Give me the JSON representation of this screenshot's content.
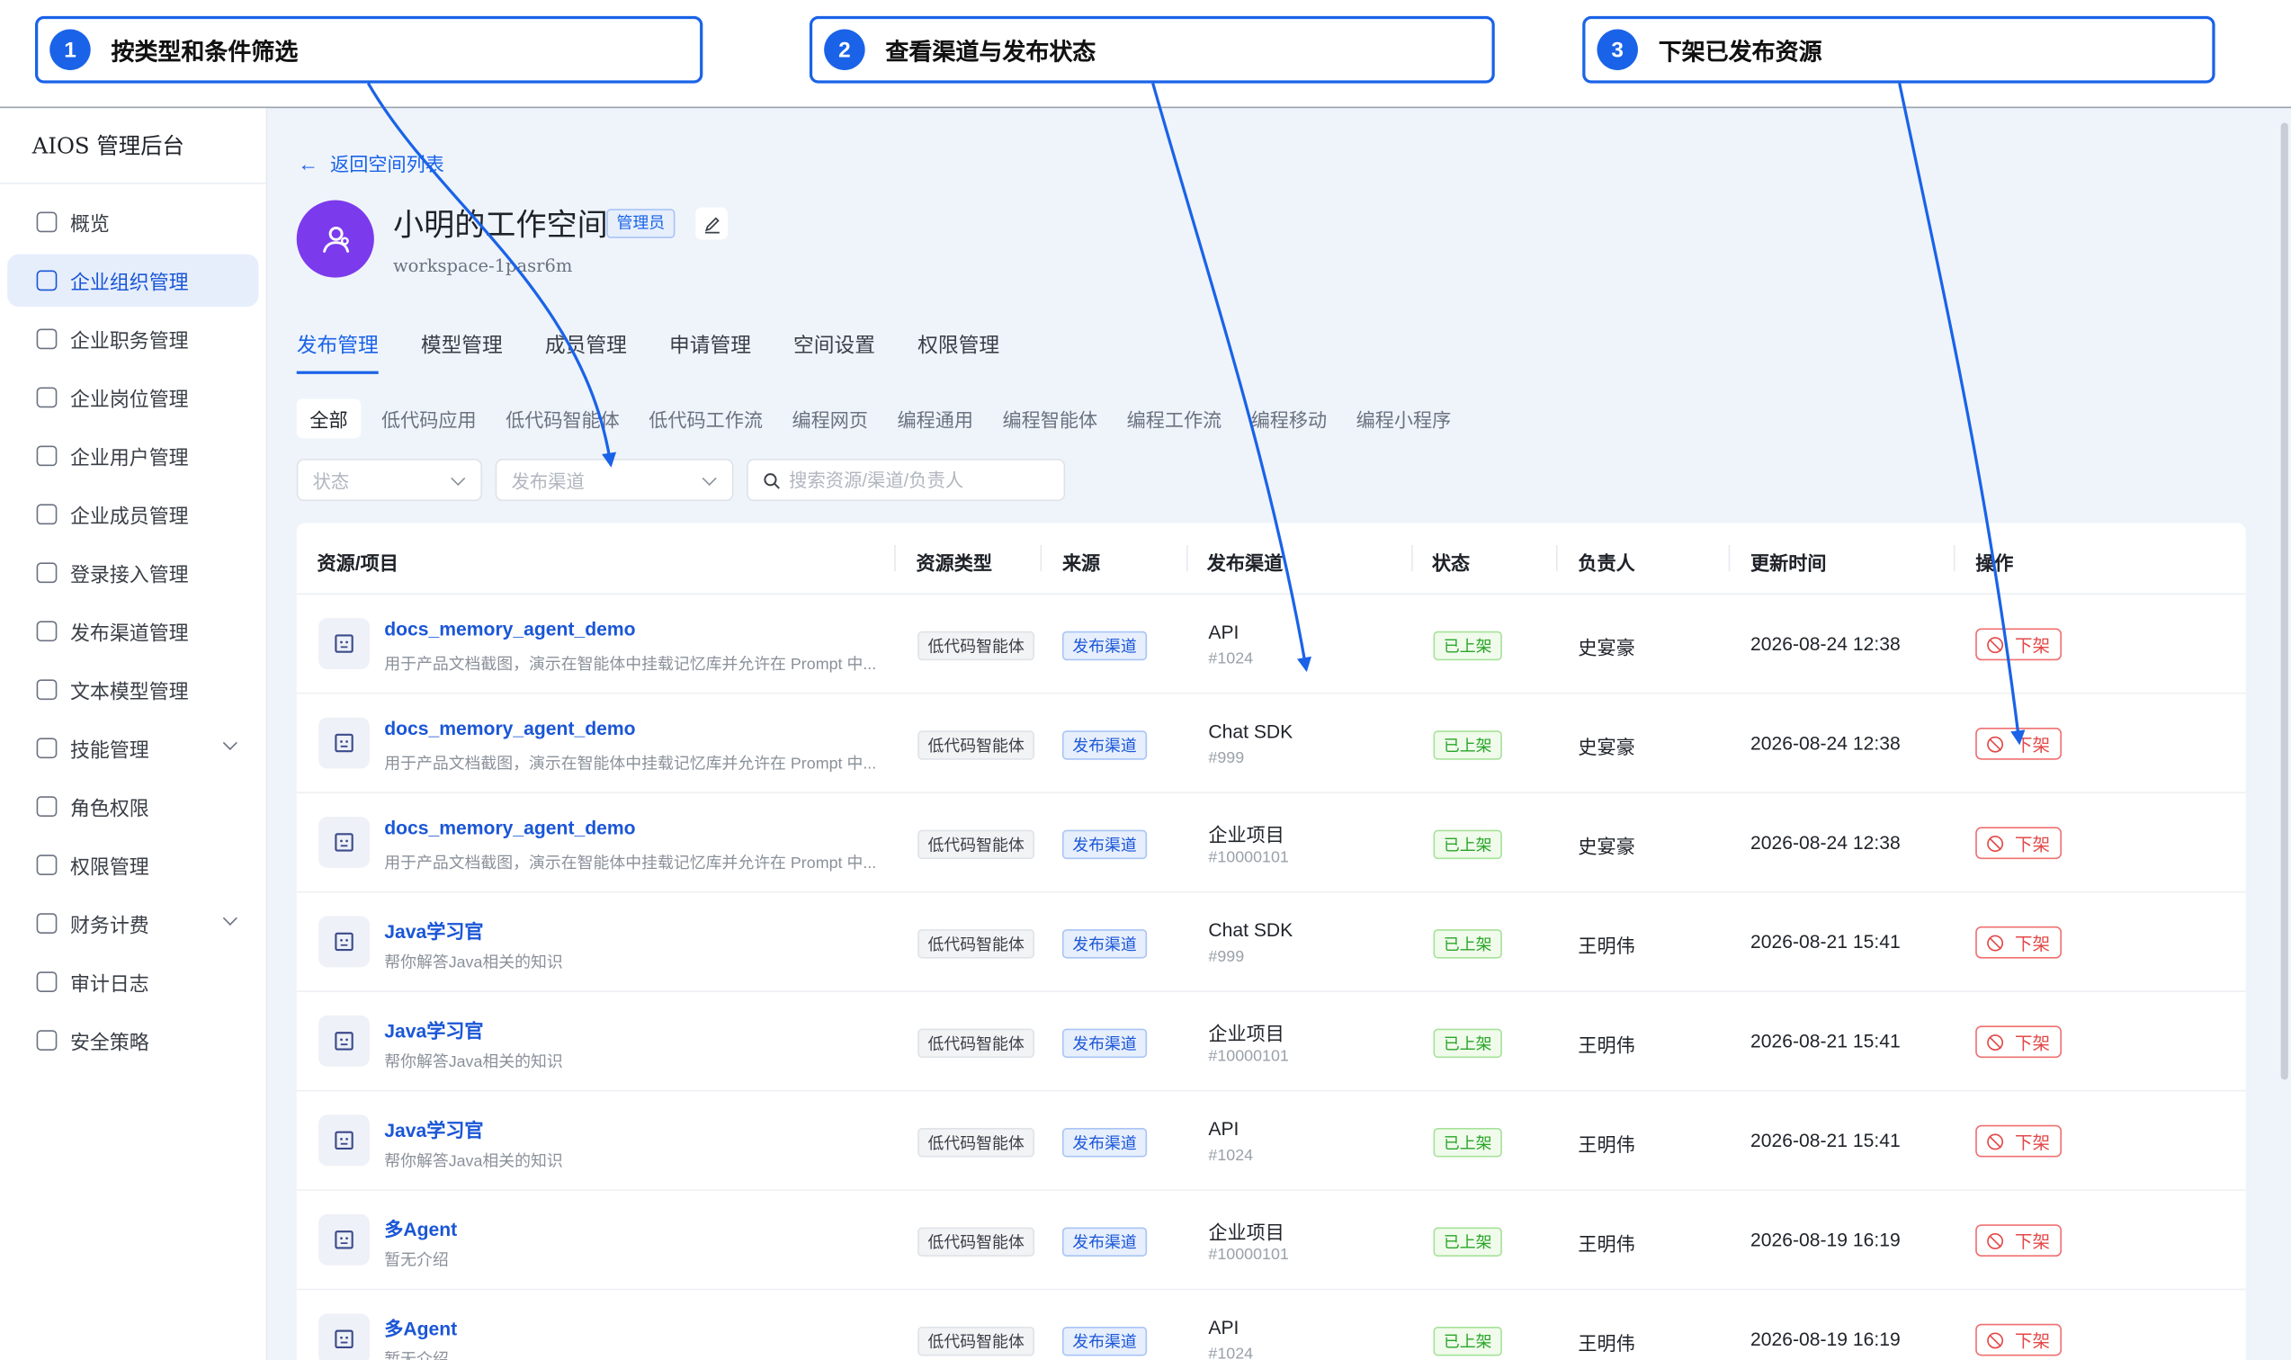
{
  "callouts": [
    {
      "num": "1",
      "text": "按类型和条件筛选"
    },
    {
      "num": "2",
      "text": "查看渠道与发布状态"
    },
    {
      "num": "3",
      "text": "下架已发布资源"
    }
  ],
  "app": {
    "title": "AIOS 管理后台"
  },
  "sidebar": {
    "items": [
      {
        "label": "概览",
        "icon": "dashboard-icon"
      },
      {
        "label": "企业组织管理",
        "icon": "building-icon"
      },
      {
        "label": "企业职务管理",
        "icon": "document-icon"
      },
      {
        "label": "企业岗位管理",
        "icon": "document-icon"
      },
      {
        "label": "企业用户管理",
        "icon": "user-icon"
      },
      {
        "label": "企业成员管理",
        "icon": "users-icon"
      },
      {
        "label": "登录接入管理",
        "icon": "key-icon"
      },
      {
        "label": "发布渠道管理",
        "icon": "bell-icon"
      },
      {
        "label": "文本模型管理",
        "icon": "model-icon"
      },
      {
        "label": "技能管理",
        "icon": "flask-icon"
      },
      {
        "label": "角色权限",
        "icon": "shield-icon"
      },
      {
        "label": "权限管理",
        "icon": "key-icon"
      },
      {
        "label": "财务计费",
        "icon": "wallet-icon"
      },
      {
        "label": "审计日志",
        "icon": "log-icon"
      },
      {
        "label": "安全策略",
        "icon": "lock-icon"
      }
    ]
  },
  "workspace": {
    "back_label": "返回空间列表",
    "title": "小明的工作空间",
    "badge": "管理员",
    "id": "workspace-1pasr6m"
  },
  "tabs": [
    "发布管理",
    "模型管理",
    "成员管理",
    "申请管理",
    "空间设置",
    "权限管理"
  ],
  "subtabs": [
    "全部",
    "低代码应用",
    "低代码智能体",
    "低代码工作流",
    "编程网页",
    "编程通用",
    "编程智能体",
    "编程工作流",
    "编程移动",
    "编程小程序"
  ],
  "filters": {
    "status_placeholder": "状态",
    "channel_placeholder": "发布渠道",
    "search_placeholder": "搜索资源/渠道/负责人"
  },
  "table": {
    "columns": [
      "资源/项目",
      "资源类型",
      "来源",
      "发布渠道",
      "状态",
      "负责人",
      "更新时间",
      "操作"
    ],
    "rows": [
      {
        "name": "docs_memory_agent_demo",
        "desc": "用于产品文档截图，演示在智能体中挂载记忆库并允许在 Prompt 中...",
        "type": "低代码智能体",
        "source": "发布渠道",
        "channel": "API",
        "channel_id": "#1024",
        "status": "已上架",
        "owner": "史宴豪",
        "time": "2026-08-24 12:38",
        "action": "下架"
      },
      {
        "name": "docs_memory_agent_demo",
        "desc": "用于产品文档截图，演示在智能体中挂载记忆库并允许在 Prompt 中...",
        "type": "低代码智能体",
        "source": "发布渠道",
        "channel": "Chat SDK",
        "channel_id": "#999",
        "status": "已上架",
        "owner": "史宴豪",
        "time": "2026-08-24 12:38",
        "action": "下架"
      },
      {
        "name": "docs_memory_agent_demo",
        "desc": "用于产品文档截图，演示在智能体中挂载记忆库并允许在 Prompt 中...",
        "type": "低代码智能体",
        "source": "发布渠道",
        "channel": "企业项目",
        "channel_id": "#10000101",
        "status": "已上架",
        "owner": "史宴豪",
        "time": "2026-08-24 12:38",
        "action": "下架"
      },
      {
        "name": "Java学习官",
        "desc": "帮你解答Java相关的知识",
        "type": "低代码智能体",
        "source": "发布渠道",
        "channel": "Chat SDK",
        "channel_id": "#999",
        "status": "已上架",
        "owner": "王明伟",
        "time": "2026-08-21 15:41",
        "action": "下架"
      },
      {
        "name": "Java学习官",
        "desc": "帮你解答Java相关的知识",
        "type": "低代码智能体",
        "source": "发布渠道",
        "channel": "企业项目",
        "channel_id": "#10000101",
        "status": "已上架",
        "owner": "王明伟",
        "time": "2026-08-21 15:41",
        "action": "下架"
      },
      {
        "name": "Java学习官",
        "desc": "帮你解答Java相关的知识",
        "type": "低代码智能体",
        "source": "发布渠道",
        "channel": "API",
        "channel_id": "#1024",
        "status": "已上架",
        "owner": "王明伟",
        "time": "2026-08-21 15:41",
        "action": "下架"
      },
      {
        "name": "多Agent",
        "desc": "暂无介绍",
        "type": "低代码智能体",
        "source": "发布渠道",
        "channel": "企业项目",
        "channel_id": "#10000101",
        "status": "已上架",
        "owner": "王明伟",
        "time": "2026-08-19 16:19",
        "action": "下架"
      },
      {
        "name": "多Agent",
        "desc": "暂无介绍",
        "type": "低代码智能体",
        "source": "发布渠道",
        "channel": "API",
        "channel_id": "#1024",
        "status": "已上架",
        "owner": "王明伟",
        "time": "2026-08-19 16:19",
        "action": "下架"
      }
    ]
  },
  "colors": {
    "accent": "#1a63e8",
    "danger": "#e34848",
    "success": "#2aa52a",
    "avatar": "#7c3aed"
  }
}
